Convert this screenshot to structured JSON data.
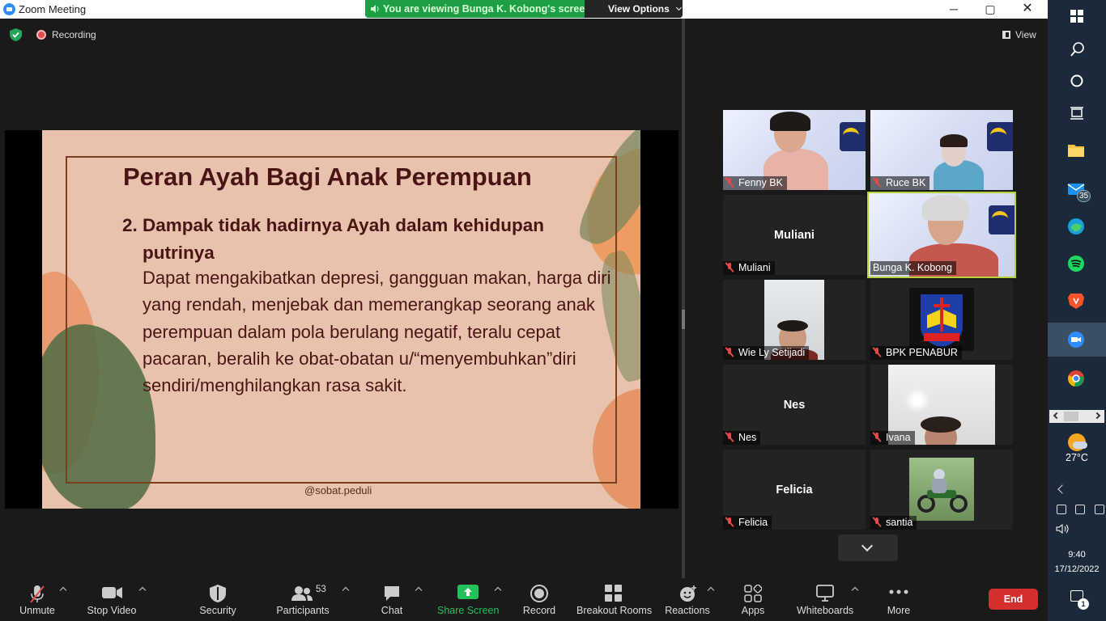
{
  "window": {
    "title": "Zoom Meeting",
    "viewing_banner": "You are viewing Bunga K. Kobong's screen",
    "view_options": "View Options",
    "minimize": "─",
    "maximize": "▢",
    "close": "✕"
  },
  "meeting": {
    "recording_label": "Recording",
    "view_label": "View"
  },
  "slide": {
    "title": "Peran Ayah Bagi Anak Perempuan",
    "point": "2. Dampak tidak hadirnya Ayah dalam kehidupan putrinya",
    "body": "Dapat mengakibatkan depresi, gangguan makan, harga diri yang rendah, menjebak dan memerangkap seorang anak perempuan dalam pola berulang negatif, teralu cepat pacaran, beralih ke obat-obatan u/“menyembuhkan”diri sendiri/menghilangkan rasa sakit.",
    "footer": "@sobat.peduli"
  },
  "participants": [
    {
      "name": "Fenny BK",
      "type": "video-banner",
      "muted": true
    },
    {
      "name": "Ruce BK",
      "type": "video-banner",
      "muted": true
    },
    {
      "name": "Muliani",
      "type": "name-only",
      "muted": true
    },
    {
      "name": "Bunga K. Kobong",
      "type": "video-banner",
      "muted": false,
      "active_speaker": true
    },
    {
      "name": "Wie Ly Setijadi",
      "type": "video-photo",
      "muted": true
    },
    {
      "name": "BPK PENABUR",
      "type": "logo",
      "muted": true
    },
    {
      "name": "Nes",
      "type": "name-only",
      "muted": true
    },
    {
      "name": "Ivana",
      "type": "video-photo",
      "muted": true
    },
    {
      "name": "Felicia",
      "type": "name-only",
      "muted": true
    },
    {
      "name": "santia",
      "type": "video-photo",
      "muted": true
    }
  ],
  "toolbar": {
    "unmute": "Unmute",
    "stop_video": "Stop Video",
    "security": "Security",
    "participants": "Participants",
    "participants_count": "53",
    "chat": "Chat",
    "share_screen": "Share Screen",
    "record": "Record",
    "breakout_rooms": "Breakout Rooms",
    "reactions": "Reactions",
    "apps": "Apps",
    "whiteboards": "Whiteboards",
    "more": "More",
    "end": "End"
  },
  "taskbar": {
    "mail_badge": "35",
    "temperature": "27°C",
    "time": "9:40",
    "date": "17/12/2022",
    "notification_count": "1"
  },
  "colors": {
    "share_green": "#1f9f45",
    "end_red": "#d32f2f",
    "active_speaker": "#b7d13b",
    "muted_red": "#e24a4a"
  }
}
